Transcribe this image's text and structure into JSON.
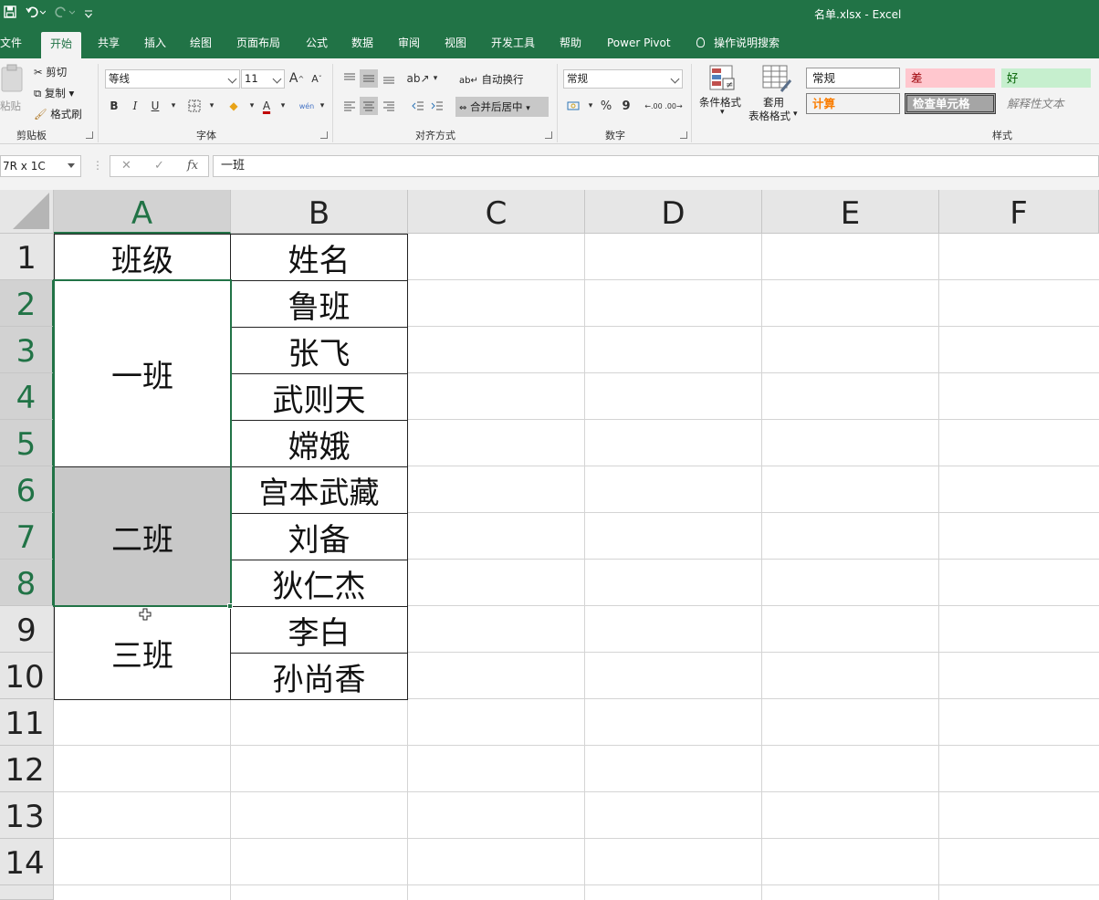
{
  "titlebar": {
    "doc_title": "名单.xlsx  -  Excel"
  },
  "tabs": [
    {
      "label": "文件"
    },
    {
      "label": "开始"
    },
    {
      "label": "共享"
    },
    {
      "label": "插入"
    },
    {
      "label": "绘图"
    },
    {
      "label": "页面布局"
    },
    {
      "label": "公式"
    },
    {
      "label": "数据"
    },
    {
      "label": "审阅"
    },
    {
      "label": "视图"
    },
    {
      "label": "开发工具"
    },
    {
      "label": "帮助"
    },
    {
      "label": "Power Pivot"
    },
    {
      "label": "操作说明搜索"
    }
  ],
  "ribbon": {
    "clipboard": {
      "paste": "粘贴",
      "cut": "剪切",
      "copy": "复制",
      "format_painter": "格式刷",
      "label": "剪贴板"
    },
    "font": {
      "name": "等线",
      "size": "11",
      "label": "字体",
      "grow": "A",
      "shrink": "A",
      "bold": "B",
      "italic": "I",
      "underline": "U",
      "fill_icon": "◆",
      "font_color_icon": "A",
      "phonetic": "wén"
    },
    "alignment": {
      "wrap": "自动换行",
      "merge": "合并后居中",
      "label": "对齐方式"
    },
    "number": {
      "format": "常规",
      "percent": "%",
      "comma": "9",
      "inc_decimal": "←.00",
      "dec_decimal": ".00→",
      "label": "数字"
    },
    "styles": {
      "cond_format": "条件格式",
      "table_format_1": "套用",
      "table_format_2": "表格格式",
      "normal": "常规",
      "bad": "差",
      "good": "好",
      "calc": "计算",
      "check": "检查单元格",
      "explain": "解释性文本",
      "label": "样式"
    }
  },
  "formula_bar": {
    "name_box": "7R x 1C",
    "cancel": "✕",
    "enter": "✓",
    "fx": "fx",
    "content": "一班"
  },
  "columns": [
    "A",
    "B",
    "C",
    "D",
    "E",
    "F"
  ],
  "rows": [
    "1",
    "2",
    "3",
    "4",
    "5",
    "6",
    "7",
    "8",
    "9",
    "10",
    "11",
    "12",
    "13",
    "14"
  ],
  "cells": {
    "A1": "班级",
    "B1": "姓名",
    "A2_5": "一班",
    "A6_8": "二班",
    "A9_10": "三班",
    "B2": "鲁班",
    "B3": "张飞",
    "B4": "武则天",
    "B5": "嫦娥",
    "B6": "宫本武藏",
    "B7": "刘备",
    "B8": "狄仁杰",
    "B9": "李白",
    "B10": "孙尚香"
  },
  "colors": {
    "accent": "#217346",
    "shade": "#c8c8c8"
  }
}
